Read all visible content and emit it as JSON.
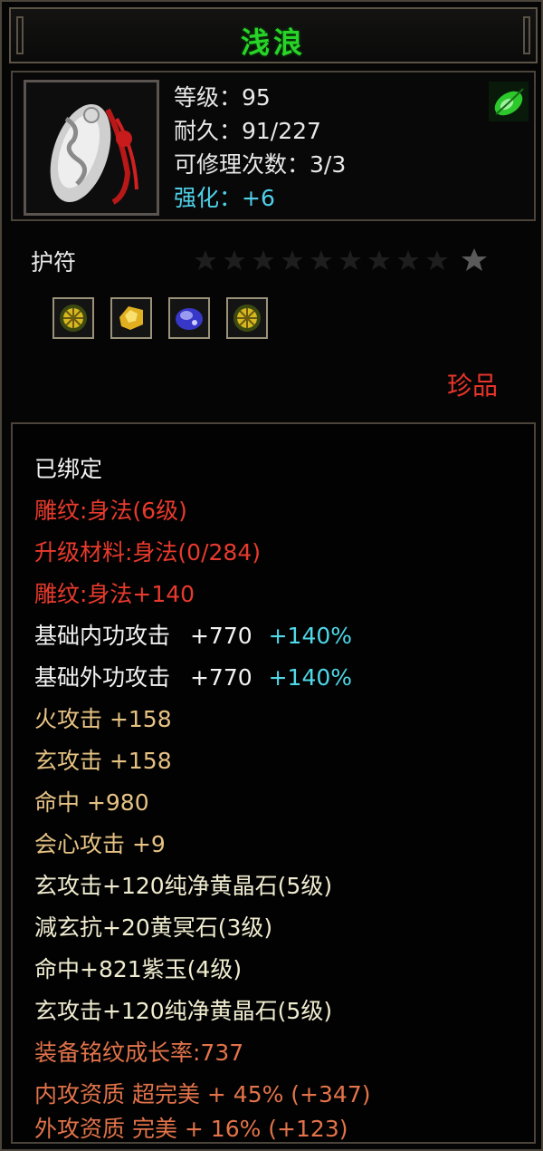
{
  "item": {
    "name": "浅浪",
    "level_text": "等级：95",
    "durability_text": "耐久：91/227",
    "repair_text": "可修理次数：3/3",
    "enhance_text": "强化：+6",
    "type": "护符",
    "quality": "珍品",
    "icon": "amulet-jade-icon",
    "corner_icon": "green-leaf-icon",
    "gems": [
      "yellow-crystal-gem-icon",
      "yellow-stone-gem-icon",
      "purple-jade-gem-icon",
      "yellow-crystal-gem-icon"
    ]
  },
  "attributes": {
    "bound": "已绑定",
    "engrave": "雕纹:身法(6级)",
    "upgrade_material": "升级材料:身法(0/284)",
    "engrave_bonus": "雕纹:身法+140",
    "inner_attack_label": "基础内功攻击",
    "inner_attack_value": "+770",
    "inner_attack_pct": "+140%",
    "outer_attack_label": "基础外功攻击",
    "outer_attack_value": "+770",
    "outer_attack_pct": "+140%",
    "fire_attack": "火攻击 +158",
    "xuan_attack": "玄攻击 +158",
    "hit": "命中 +980",
    "crit": "会心攻击 +9",
    "socket1": "玄攻击+120纯净黄晶石(5级)",
    "socket2": "減玄抗+20黄冥石(3级)",
    "socket3": "命中+821紫玉(4级)",
    "socket4": "玄攻击+120纯净黄晶石(5级)",
    "growth_rate": "装备铭纹成长率:737",
    "inner_quality": "内攻资质 超完美 + 45% (+347)",
    "outer_quality": "外攻资质 完美 + 16% (+123)"
  },
  "colors": {
    "title": "#28d428",
    "engrave_red": "#e83a2c",
    "gold": "#e6c283",
    "cyan": "#4fd8e8",
    "orange": "#e2734a"
  }
}
